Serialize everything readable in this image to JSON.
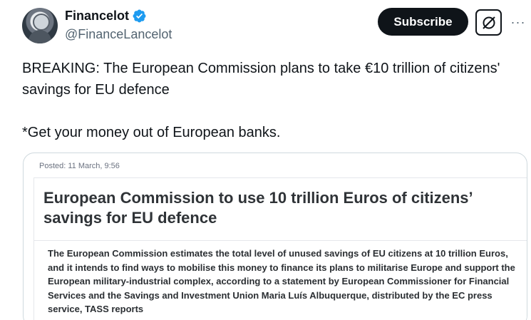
{
  "account": {
    "display_name": "Financelot",
    "handle": "@FinanceLancelot",
    "verified_icon": "verified-badge-icon",
    "verified_color": "#1d9bf0"
  },
  "actions": {
    "subscribe_label": "Subscribe",
    "grok_icon": "grok-icon",
    "more_label": "···"
  },
  "tweet": {
    "line1": "BREAKING: The European Commission plans to take €10 trillion of citizens' savings for EU defence",
    "line2": "*Get your money out of European banks."
  },
  "media": {
    "posted": "Posted: 11 March, 9:56",
    "headline": "European Commission to use 10 trillion Euros of citizens’ savings for EU defence",
    "body": "The European Commission estimates the total level of unused savings of EU citizens at 10 trillion Euros, and it intends to find ways to mobilise this money to finance its plans to militarise Europe and support the European military-industrial complex, according to a statement by European Commissioner for Financial Services and the Savings and Investment Union Maria Luís Albuquerque, distributed by the EC press service, TASS reports"
  }
}
